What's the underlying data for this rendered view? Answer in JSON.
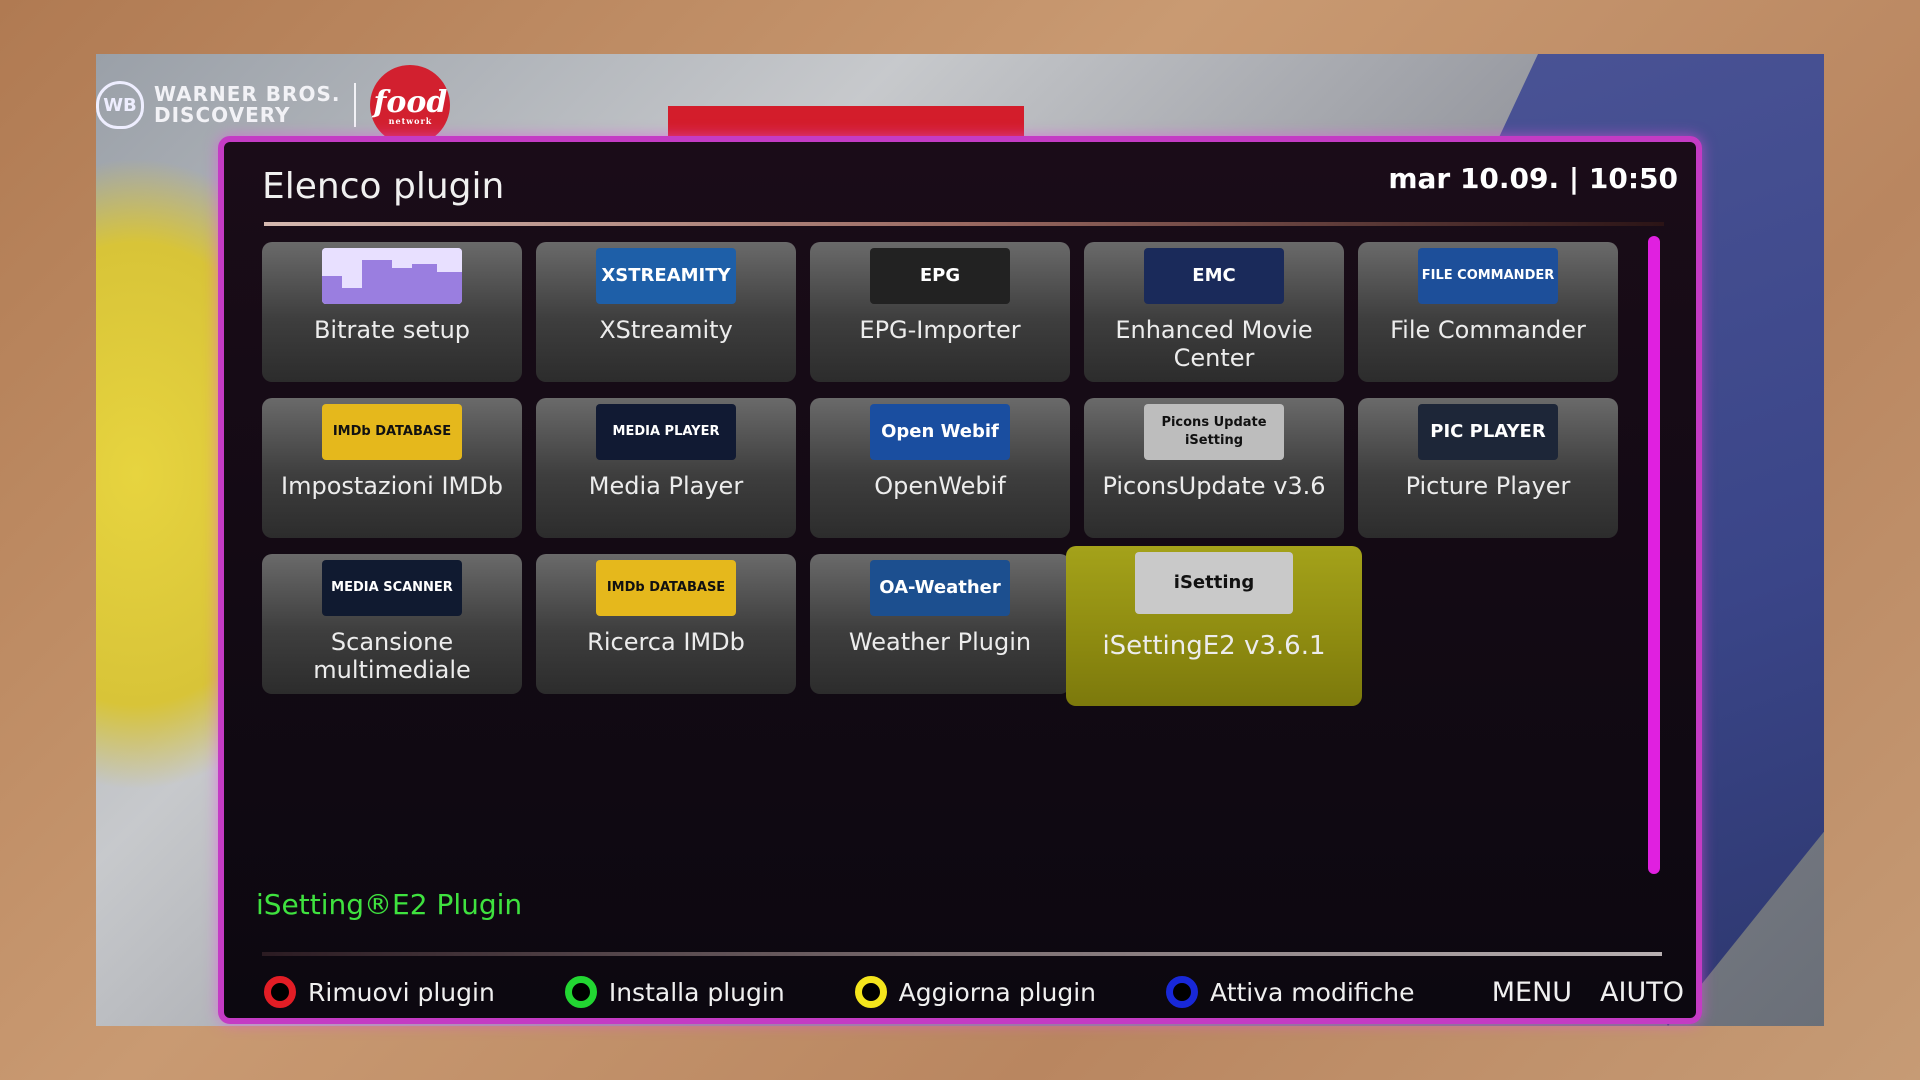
{
  "screen": {
    "title": "Elenco plugin",
    "clock": "mar 10.09. | 10:50"
  },
  "channel": {
    "network_logo_line1": "WARNER BROS.",
    "network_logo_line2": "DISCOVERY",
    "channel_logo": "food",
    "channel_logo_sub": "network"
  },
  "plugins": [
    {
      "label": "Bitrate setup",
      "icon": "bitrate-icon",
      "icon_color": "#c9b4ff"
    },
    {
      "label": "XStreamity",
      "icon": "xstreamity-icon",
      "icon_text": "XSTREAMITY",
      "icon_color": "#1e5fa8"
    },
    {
      "label": "EPG-Importer",
      "icon": "epg-icon",
      "icon_text": "EPG",
      "icon_color": "#222222"
    },
    {
      "label": "Enhanced Movie Center",
      "icon": "emc-icon",
      "icon_text": "EMC",
      "icon_color": "#1a2a5a"
    },
    {
      "label": "File Commander",
      "icon": "file-commander-icon",
      "icon_text": "FILE COMMANDER",
      "icon_color": "#1d4f9a"
    },
    {
      "label": "Impostazioni IMDb",
      "icon": "imdb-database-icon",
      "icon_text": "IMDb DATABASE",
      "icon_color": "#e5b81c"
    },
    {
      "label": "Media Player",
      "icon": "media-player-icon",
      "icon_text": "MEDIA PLAYER",
      "icon_color": "#111a33"
    },
    {
      "label": "OpenWebif",
      "icon": "openwebif-icon",
      "icon_text": "Open Webif",
      "icon_color": "#1a4ea0"
    },
    {
      "label": "PiconsUpdate v3.6",
      "icon": "picons-update-icon",
      "icon_text": "Picons Update iSetting",
      "icon_color": "#bdbdbd"
    },
    {
      "label": "Picture Player",
      "icon": "picture-player-icon",
      "icon_text": "PIC PLAYER",
      "icon_color": "#1d2638"
    },
    {
      "label": "Scansione multimediale",
      "icon": "media-scanner-icon",
      "icon_text": "MEDIA SCANNER",
      "icon_color": "#101a30"
    },
    {
      "label": "Ricerca IMDb",
      "icon": "imdb-search-icon",
      "icon_text": "IMDb DATABASE",
      "icon_color": "#e5b81c"
    },
    {
      "label": "Weather Plugin",
      "icon": "weather-icon",
      "icon_text": "OA-Weather",
      "icon_color": "#1c4f8f"
    },
    {
      "label": "iSettingE2 v3.6.1",
      "icon": "isetting-icon",
      "icon_text": "iSetting",
      "icon_color": "#c9c9c9",
      "selected": true
    }
  ],
  "status": "iSetting®E2 Plugin",
  "footer": {
    "red": "Rimuovi plugin",
    "green": "Installa plugin",
    "yellow": "Aggiorna plugin",
    "blue": "Attiva modifiche",
    "menu": "MENU",
    "help": "AIUTO"
  },
  "colors": {
    "accent": "#c43bc4",
    "selection": "#8d8a10",
    "status_green": "#3fe23f",
    "key_red": "#e21d25",
    "key_green": "#22d632",
    "key_yellow": "#f4e51c",
    "key_blue": "#1828d8"
  }
}
